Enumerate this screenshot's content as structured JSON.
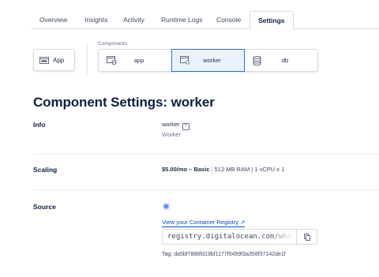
{
  "tabs": [
    {
      "label": "Overview"
    },
    {
      "label": "Insights"
    },
    {
      "label": "Activity"
    },
    {
      "label": "Runtime Logs"
    },
    {
      "label": "Console"
    },
    {
      "label": "Settings",
      "active": true
    }
  ],
  "app_button": {
    "label": "App",
    "icon": "window-icon"
  },
  "components": {
    "label": "Components:",
    "items": [
      {
        "label": "app",
        "icon": "app-globe-icon"
      },
      {
        "label": "worker",
        "icon": "worker-gear-icon",
        "selected": true
      },
      {
        "label": "db",
        "icon": "database-icon"
      }
    ]
  },
  "page_title": "Component Settings: worker",
  "info": {
    "label": "Info",
    "name": "worker",
    "help": "?",
    "description": "Worker"
  },
  "scaling": {
    "label": "Scaling",
    "price": "$5.00/mo – Basic",
    "spec": "512 MB RAM | 1 vCPU",
    "count": "x 1"
  },
  "source": {
    "label": "Source",
    "icon": "container-registry-icon",
    "link_label": "View your Container Registry ↗",
    "image": "registry.digitalocean.com/whiskeydemo",
    "tag_label": "Tag:",
    "tag_value": "da5bf7888fd19bf1177f5499f3a358f37142de1f"
  },
  "colors": {
    "accent": "#0050d8",
    "heading": "#0b1f44",
    "border": "#d6dbe3",
    "selected_bg": "#eaf2fe"
  }
}
